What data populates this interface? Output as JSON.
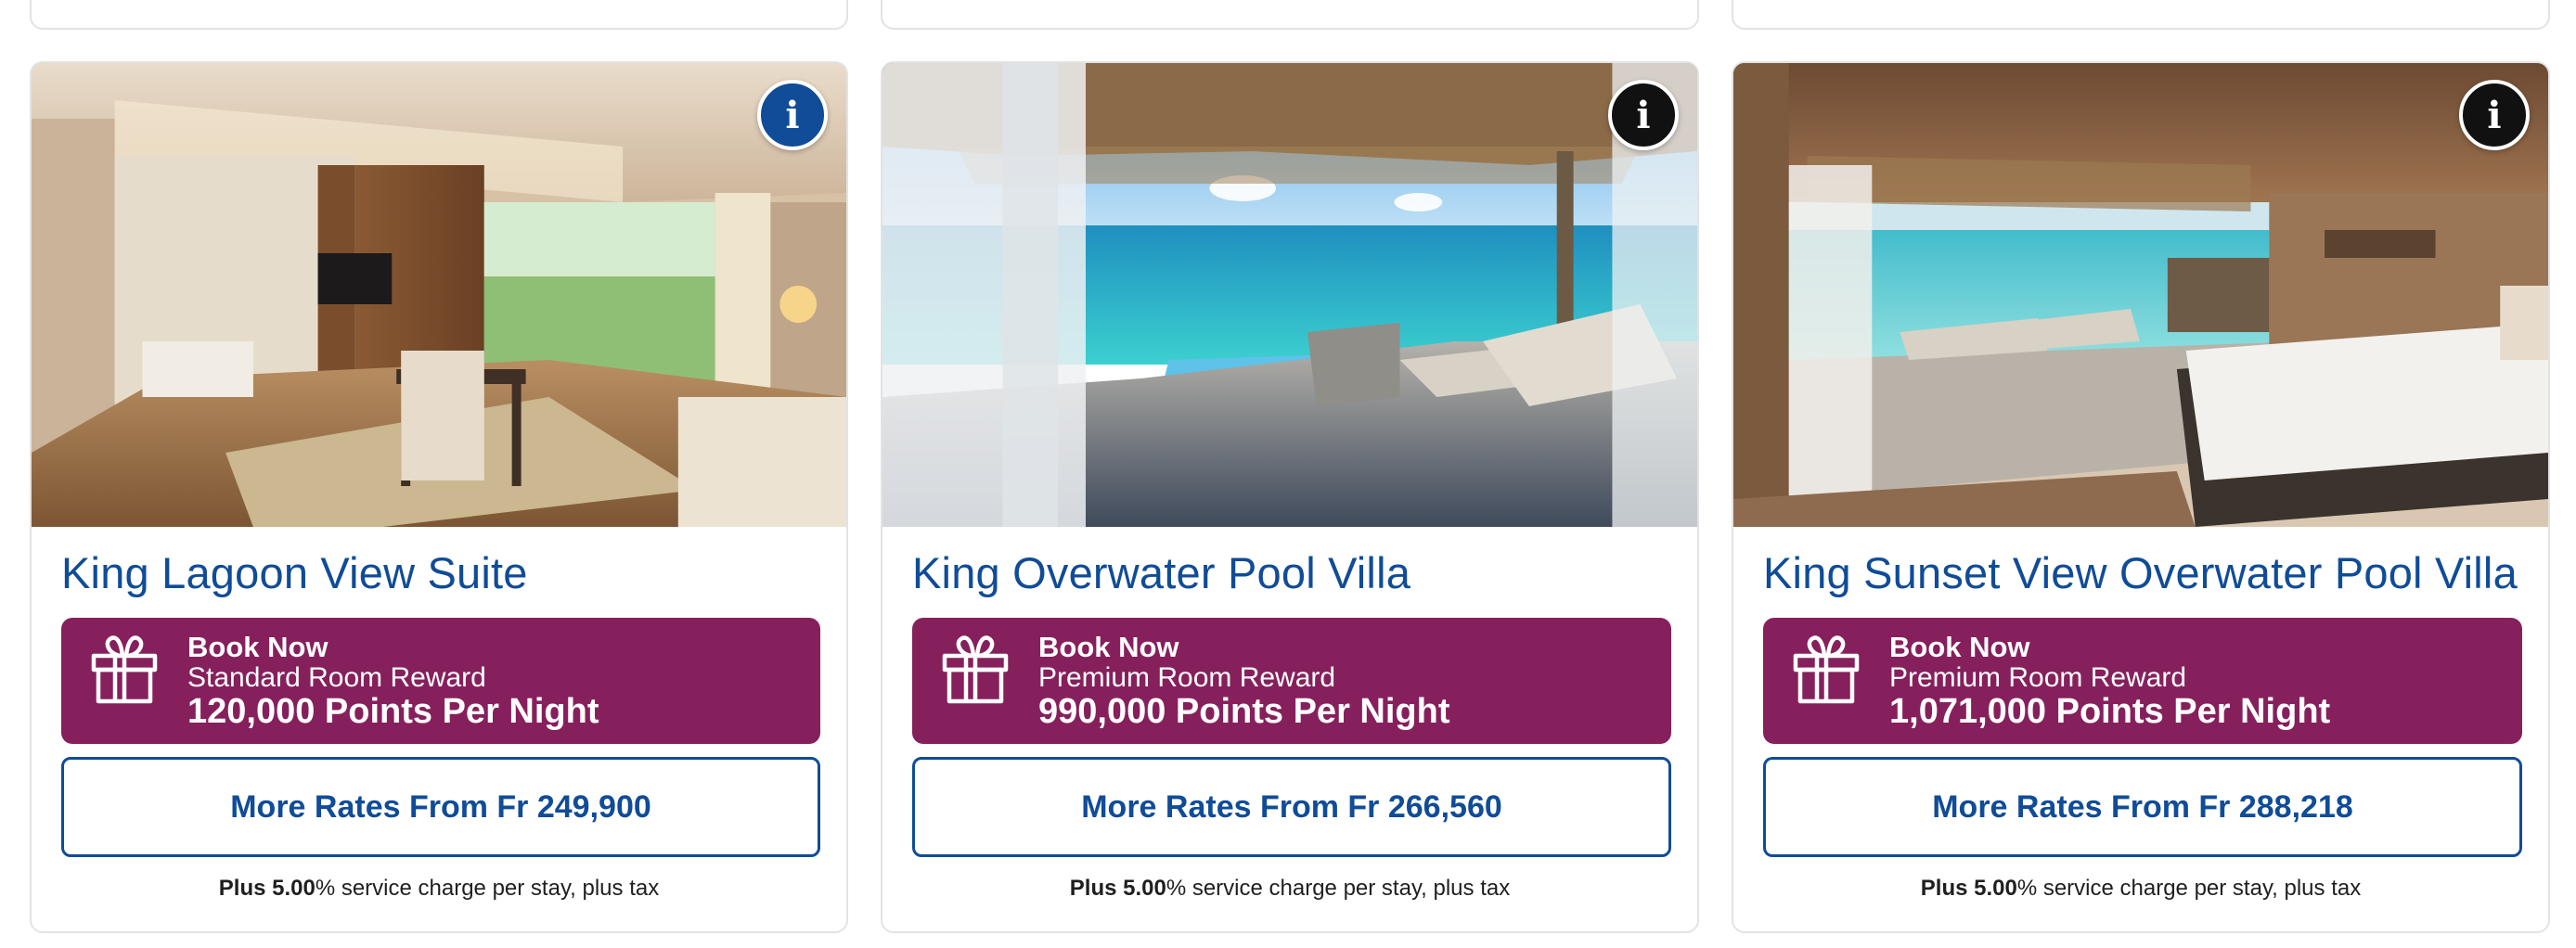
{
  "colors": {
    "brand_blue": "#104c97",
    "reward_purple": "#86205d",
    "card_border": "#e3e3e3",
    "info_dark": "#111111"
  },
  "rooms": [
    {
      "title": "King Lagoon View Suite",
      "image_alt": "Suite living room with wood paneling opening onto a lagoon terrace",
      "info_icon": "info-icon",
      "info_style": "blue",
      "reward": {
        "icon": "gift-icon",
        "book": "Book Now",
        "tier": "Standard Room Reward",
        "points": "120,000 Points Per Night"
      },
      "more_rates": "More Rates From Fr 249,900",
      "fee_bold": "Plus 5.00",
      "fee_rest": "% service charge per stay, plus tax"
    },
    {
      "title": "King Overwater Pool Villa",
      "image_alt": "Overwater villa deck with plunge pool and loungers facing turquoise sea",
      "info_icon": "info-icon",
      "info_style": "black",
      "reward": {
        "icon": "gift-icon",
        "book": "Book Now",
        "tier": "Premium Room Reward",
        "points": "990,000 Points Per Night"
      },
      "more_rates": "More Rates From Fr 266,560",
      "fee_bold": "Plus 5.00",
      "fee_rest": "% service charge per stay, plus tax"
    },
    {
      "title": "King Sunset View Overwater Pool Villa",
      "image_alt": "Overwater villa bedroom opening to a deck, pool and lagoon",
      "info_icon": "info-icon",
      "info_style": "black",
      "reward": {
        "icon": "gift-icon",
        "book": "Book Now",
        "tier": "Premium Room Reward",
        "points": "1,071,000 Points Per Night"
      },
      "more_rates": "More Rates From Fr 288,218",
      "fee_bold": "Plus 5.00",
      "fee_rest": "% service charge per stay, plus tax"
    }
  ]
}
